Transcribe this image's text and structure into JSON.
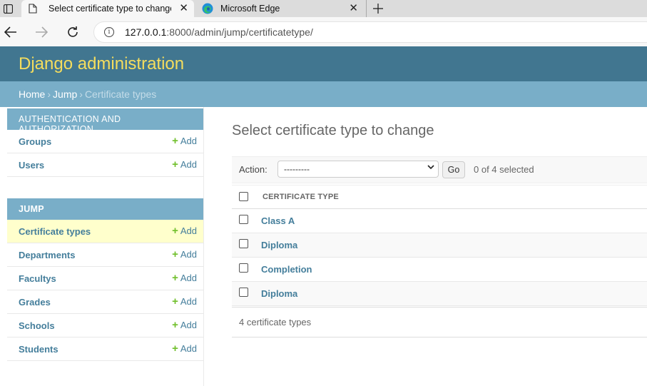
{
  "browser": {
    "tabs": [
      {
        "title": "Select certificate type to change",
        "active": true
      },
      {
        "title": "Microsoft Edge",
        "active": false
      }
    ],
    "url_host": "127.0.0.1",
    "url_path": ":8000/admin/jump/certificatetype/"
  },
  "header": {
    "site_title": "Django administration"
  },
  "breadcrumbs": {
    "home": "Home",
    "app": "Jump",
    "current": "Certificate types",
    "separator": "›"
  },
  "sidebar": {
    "modules": [
      {
        "caption": "AUTHENTICATION AND AUTHORIZATION",
        "models": [
          {
            "name": "Groups",
            "add": "Add"
          },
          {
            "name": "Users",
            "add": "Add"
          }
        ]
      },
      {
        "caption": "JUMP",
        "models": [
          {
            "name": "Certificate types",
            "add": "Add",
            "current": true
          },
          {
            "name": "Departments",
            "add": "Add"
          },
          {
            "name": "Facultys",
            "add": "Add"
          },
          {
            "name": "Grades",
            "add": "Add"
          },
          {
            "name": "Schools",
            "add": "Add"
          },
          {
            "name": "Students",
            "add": "Add"
          }
        ]
      }
    ]
  },
  "content": {
    "title": "Select certificate type to change",
    "action_label": "Action:",
    "action_selected": "---------",
    "go_label": "Go",
    "selected_count": "0 of 4 selected",
    "column_header": "CERTIFICATE TYPE",
    "rows": [
      "Class A",
      "Diploma",
      "Completion",
      "Diploma"
    ],
    "paginator": "4 certificate types"
  },
  "colors": {
    "header_bg": "#417690",
    "title_yellow": "#f5dd5d",
    "breadcrumb_bg": "#79aec8",
    "link_blue": "#447e9b",
    "add_green": "#70bf2b",
    "current_row_bg": "#ffffcc"
  }
}
